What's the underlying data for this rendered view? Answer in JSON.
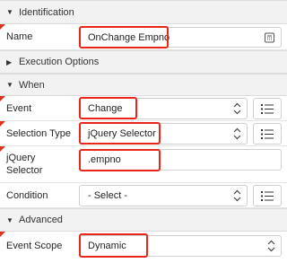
{
  "sections": {
    "identification": "Identification",
    "execution_options": "Execution Options",
    "when": "When",
    "advanced": "Advanced"
  },
  "fields": {
    "name": {
      "label": "Name",
      "value": "OnChange Empno"
    },
    "event": {
      "label": "Event",
      "value": "Change"
    },
    "selection_type": {
      "label": "Selection Type",
      "value": "jQuery Selector"
    },
    "jquery_selector": {
      "label_line1": "jQuery",
      "label_line2": "Selector",
      "value": ".empno"
    },
    "condition": {
      "label": "Condition",
      "value": "- Select -"
    },
    "event_scope": {
      "label": "Event Scope",
      "value": "Dynamic"
    }
  },
  "icons": {
    "expanded": "caret-down-icon",
    "collapsed": "caret-right-icon",
    "stepper": "up-down-chevron-icon",
    "list": "list-icon",
    "calculator": "calculator-icon"
  },
  "colors": {
    "highlight": "#e8261a",
    "required_marker": "#e0331f",
    "section_bg": "#f2f2f2"
  }
}
